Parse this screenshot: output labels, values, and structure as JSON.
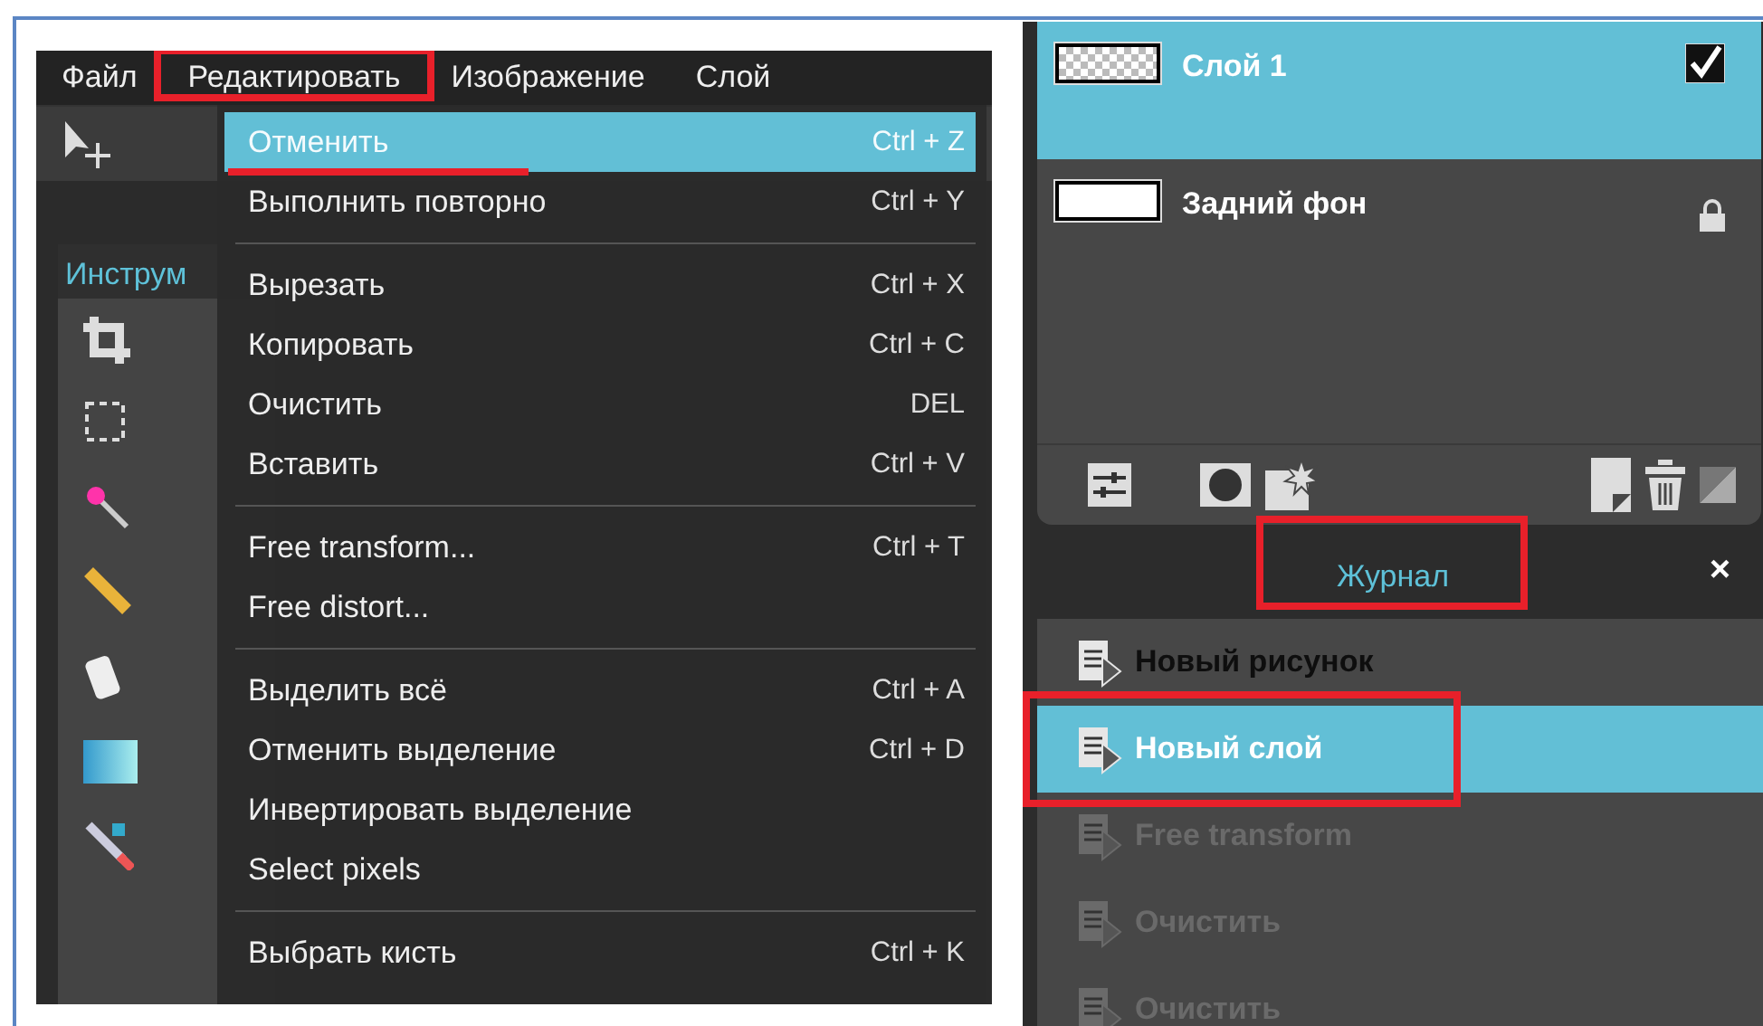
{
  "menubar": [
    {
      "label": "Файл",
      "highlighted": false
    },
    {
      "label": "Редактировать",
      "highlighted": true
    },
    {
      "label": "Изображение",
      "highlighted": false
    },
    {
      "label": "Слой",
      "highlighted": false
    }
  ],
  "tools_panel": {
    "title": "Инструм"
  },
  "edit_menu": [
    {
      "kind": "item",
      "label": "Отменить",
      "shortcut": "Ctrl + Z",
      "selected": true,
      "underlined": true
    },
    {
      "kind": "item",
      "label": "Выполнить повторно",
      "shortcut": "Ctrl + Y",
      "selected": false,
      "underlined": false
    },
    {
      "kind": "separator"
    },
    {
      "kind": "item",
      "label": "Вырезать",
      "shortcut": "Ctrl + X",
      "selected": false,
      "underlined": false
    },
    {
      "kind": "item",
      "label": "Копировать",
      "shortcut": "Ctrl + C",
      "selected": false,
      "underlined": false
    },
    {
      "kind": "item",
      "label": "Очистить",
      "shortcut": "DEL",
      "selected": false,
      "underlined": false
    },
    {
      "kind": "item",
      "label": "Вставить",
      "shortcut": "Ctrl + V",
      "selected": false,
      "underlined": false
    },
    {
      "kind": "separator"
    },
    {
      "kind": "item",
      "label": "Free transform...",
      "shortcut": "Ctrl + T",
      "selected": false,
      "underlined": false
    },
    {
      "kind": "item",
      "label": "Free distort...",
      "selected": false,
      "underlined": false
    },
    {
      "kind": "separator"
    },
    {
      "kind": "item",
      "label": "Выделить всё",
      "shortcut": "Ctrl + A",
      "selected": false,
      "underlined": false
    },
    {
      "kind": "item",
      "label": "Отменить выделение",
      "shortcut": "Ctrl + D",
      "selected": false,
      "underlined": false
    },
    {
      "kind": "item",
      "label": "Инвертировать выделение",
      "selected": false,
      "underlined": false
    },
    {
      "kind": "item",
      "label": "Select pixels",
      "selected": false,
      "underlined": false
    },
    {
      "kind": "separator"
    },
    {
      "kind": "item",
      "label": "Выбрать кисть",
      "shortcut": "Ctrl + K",
      "selected": false,
      "underlined": false
    }
  ],
  "layers": [
    {
      "name": "Слой 1",
      "selected": true,
      "kind": "toggle",
      "checked": true
    },
    {
      "name": "Задний фон",
      "selected": false,
      "kind": "locked"
    }
  ],
  "history": {
    "title": "Журнал",
    "title_highlighted": true,
    "close": "×",
    "items": [
      {
        "label": "Новый рисунок",
        "selected": false,
        "undone": false,
        "highlighted": false
      },
      {
        "label": "Новый слой",
        "selected": true,
        "undone": false,
        "highlighted": true
      },
      {
        "label": "Free transform",
        "selected": false,
        "undone": true,
        "highlighted": false
      },
      {
        "label": "Очистить",
        "selected": false,
        "undone": true,
        "highlighted": false
      },
      {
        "label": "Очистить",
        "selected": false,
        "undone": true,
        "highlighted": false
      }
    ]
  }
}
